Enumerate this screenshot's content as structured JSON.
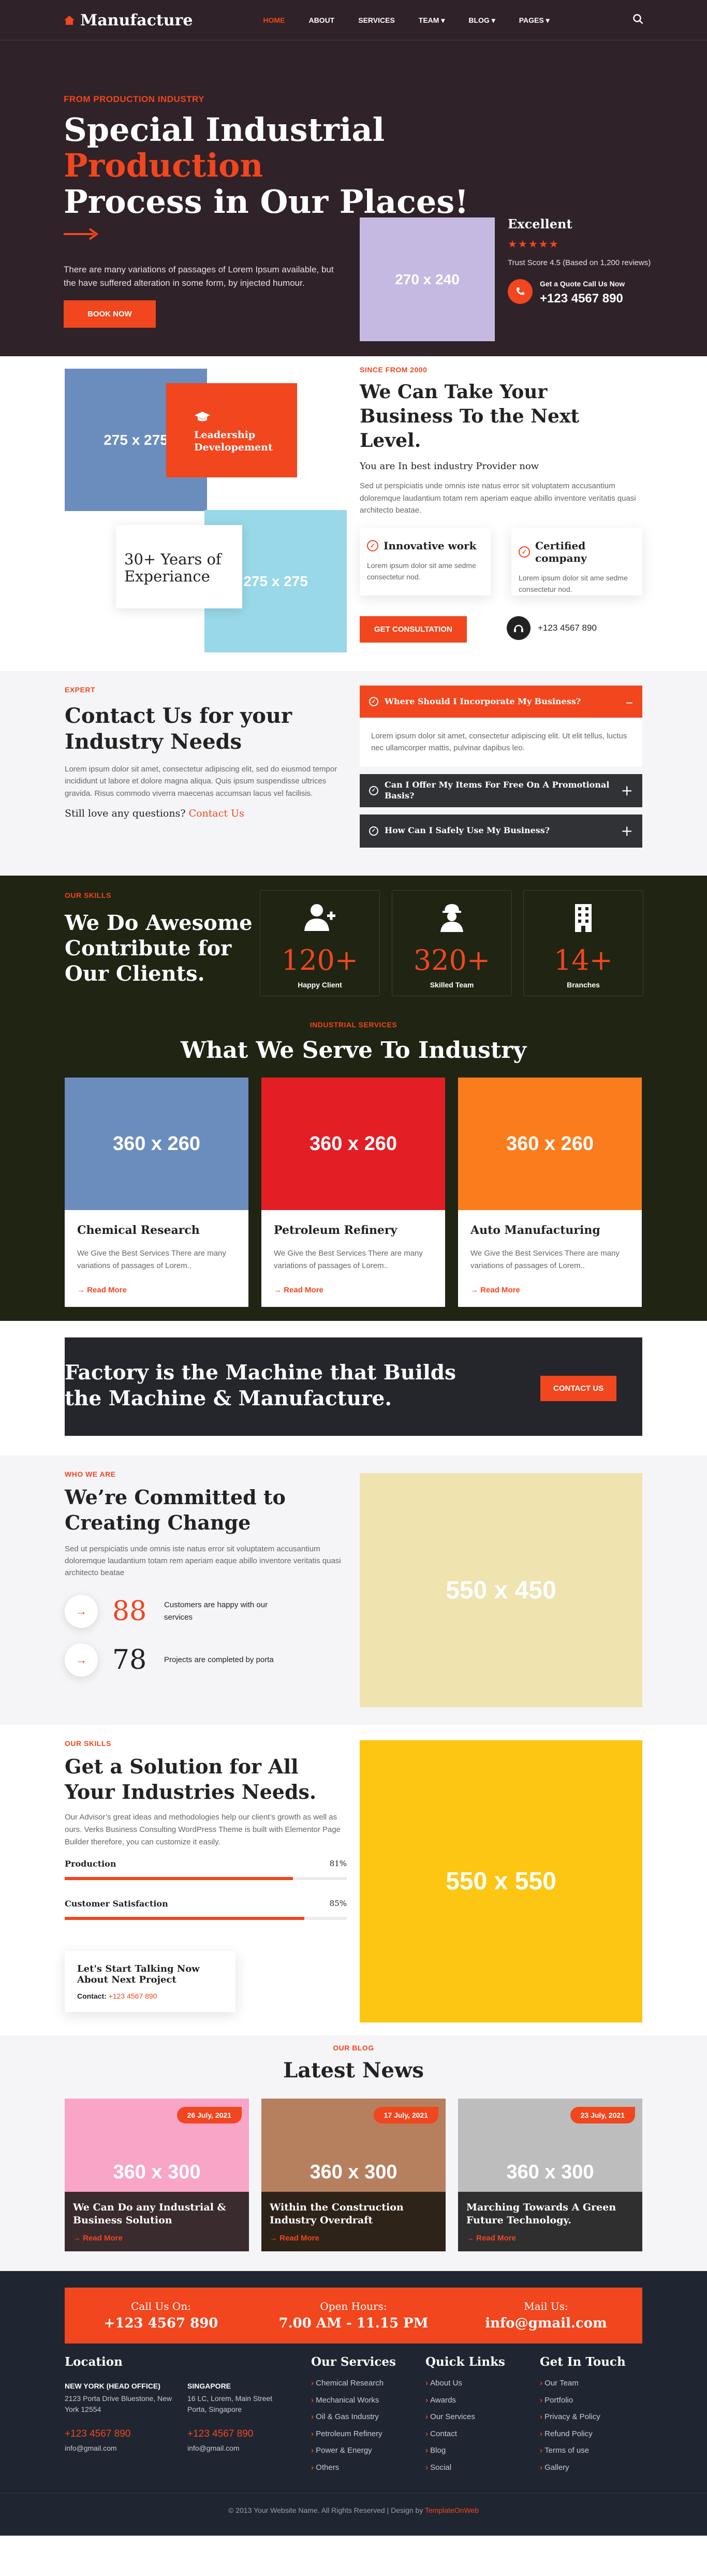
{
  "header": {
    "logo": "Manufacture",
    "nav": [
      {
        "label": "HOME"
      },
      {
        "label": "ABOUT"
      },
      {
        "label": "SERVICES"
      },
      {
        "label": "TEAM"
      },
      {
        "label": "BLOG"
      },
      {
        "label": "PAGES"
      }
    ]
  },
  "hero": {
    "kicker": "FROM PRODUCTION INDUSTRY",
    "title_a": "Special Industrial ",
    "title_b": "Production",
    "title_c": "Process in Our Places!",
    "desc": "There are many variations of passages of Lorem Ipsum available, but the have suffered alteration in some form, by injected humour.",
    "btn": "BOOK NOW",
    "img": "270 x 240",
    "rating_title": "Excellent",
    "stars": "★★★★★",
    "trust": "Trust Score 4.5 (Based on 1,200 reviews)",
    "call_label": "Get a Quote Call Us Now",
    "call_phone": "+123 4567 890"
  },
  "about": {
    "img1": "275 x 275",
    "badge": "Leadership Developement",
    "img2": "275 x 275",
    "years": "30+ Years of Experiance",
    "kicker": "SINCE FROM 2000",
    "title": "We Can Take Your Business To the Next Level.",
    "sub": "You are In best industry Provider now",
    "para": "Sed ut perspiciatis unde omnis iste natus error sit voluptatem accusantium doloremque laudantium totam rem aperiam eaque abillo inventore veritatis quasi architecto beatae.",
    "feats": [
      {
        "title": "Innovative work",
        "text": "Lorem ipsum dolor sit ame sedme consectetur nod."
      },
      {
        "title": "Certified company",
        "text": "Lorem ipsum dolor sit ame sedme consectetur nod."
      }
    ],
    "btn": "GET CONSULTATION",
    "phone": "+123 4567 890"
  },
  "faq": {
    "kicker": "EXPERT",
    "title": "Contact Us for your Industry Needs",
    "para": "Lorem ipsum dolor sit amet, consectetur adipiscing elit, sed do eiusmod tempor incididunt ut labore et dolore magna aliqua. Quis ipsum suspendisse ultrices gravida. Risus commodo viverra maecenas accumsan lacus vel facilisis.",
    "question": "Still love any questions?",
    "contact": "Contact Us",
    "items": [
      {
        "q": "Where Should I Incorporate My Business?",
        "a": "Lorem ipsum dolor sit amet, consectetur adipiscing elit. Ut elit tellus, luctus nec ullamcorper mattis, pulvinar dapibus leo."
      },
      {
        "q": "Can I Offer My Items For Free On A Promotional Basis?"
      },
      {
        "q": "How Can I Safely Use My Business?"
      }
    ]
  },
  "stats": {
    "kicker": "OUR SKILLS",
    "title": "We Do Awesome Contribute for Our Clients.",
    "items": [
      {
        "num": "120+",
        "label": "Happy Client"
      },
      {
        "num": "320+",
        "label": "Skilled Team"
      },
      {
        "num": "14+",
        "label": "Branches"
      }
    ]
  },
  "services": {
    "kicker": "INDUSTRIAL SERVICES",
    "title": "What We Serve To Industry",
    "items": [
      {
        "img": "360 x 260",
        "title": "Chemical Research",
        "text": "We Give the Best Services There are many variations of passages of Lorem..",
        "more": "Read More"
      },
      {
        "img": "360 x 260",
        "title": "Petroleum Refinery",
        "text": "We Give the Best Services There are many variations of passages of Lorem..",
        "more": "Read More"
      },
      {
        "img": "360 x 260",
        "title": "Auto Manufacturing",
        "text": "We Give the Best Services There are many variations of passages of Lorem..",
        "more": "Read More"
      }
    ]
  },
  "cta": {
    "title": "Factory is the Machine that Builds the Machine & Manufacture.",
    "btn": "CONTACT US"
  },
  "commit": {
    "kicker": "WHO WE ARE",
    "title": "We’re Committed to Creating Change",
    "para": "Sed ut perspiciatis unde omnis iste natus error sit voluptatem accusantium doloremque laudantium totam rem aperiam eaque abillo inventore veritatis quasi architecto beatae",
    "stats": [
      {
        "num": "88",
        "text": "Customers are happy with our services"
      },
      {
        "num": "78",
        "text": "Projects are completed by porta"
      }
    ],
    "img": "550 x 450"
  },
  "skills": {
    "kicker": "OUR SKILLS",
    "title": "Get a Solution for All Your Industries Needs.",
    "para": "Our Advisor’s great ideas and methodologies help our client’s growth as well as ours. Verks Business Consulting WordPress Theme is built with Elementor Page Builder therefore, you can customize it easily.",
    "bars": [
      {
        "label": "Production",
        "pct": "81%",
        "value": 0.81
      },
      {
        "label": "Customer Satisfaction",
        "pct": "85%",
        "value": 0.85
      }
    ],
    "talk_title": "Let's Start Talking Now About Next Project",
    "talk_contact": "Contact:",
    "talk_phone": "+123 4567 890",
    "img": "550 x 550"
  },
  "blog": {
    "kicker": "OUR BLOG",
    "title": "Latest News",
    "posts": [
      {
        "date": "26 July, 2021",
        "img": "360 x 300",
        "title": "We Can Do any Industrial & Business Solution",
        "more": "Read More"
      },
      {
        "date": "17 July, 2021",
        "img": "360 x 300",
        "title": "Within the Construction Industry Overdraft",
        "more": "Read More"
      },
      {
        "date": "23 July, 2021",
        "img": "360 x 300",
        "title": "Marching Towards A Green Future Technology.",
        "more": "Read More"
      }
    ]
  },
  "footer": {
    "bar": [
      {
        "a": "Call Us On:",
        "b": "+123 4567 890"
      },
      {
        "a": "Open Hours:",
        "b": "7.00 AM - 11.15 PM"
      },
      {
        "a": "Mail Us:",
        "b": "info@gmail.com"
      }
    ],
    "location": {
      "title": "Location",
      "offices": [
        {
          "name": "NEW YORK (HEAD OFFICE)",
          "addr": "2123 Porta Drive Bluestone, New York 12554",
          "phone": "+123 4567 890",
          "mail": "info@gmail.com"
        },
        {
          "name": "SINGAPORE",
          "addr": "16 LC, Lorem, Main Street Porta, Singapore",
          "phone": "+123 4567 890",
          "mail": "info@gmail.com"
        }
      ]
    },
    "services": {
      "title": "Our Services",
      "items": [
        "Chemical Research",
        "Mechanical Works",
        "Oil & Gas Industry",
        "Petroleum Refinery",
        "Power & Energy",
        "Others"
      ]
    },
    "links": {
      "title": "Quick Links",
      "items": [
        "About Us",
        "Awards",
        "Our Services",
        "Contact",
        "Blog",
        "Social"
      ]
    },
    "touch": {
      "title": "Get In Touch",
      "items": [
        "Our Team",
        "Portfolio",
        "Privacy & Policy",
        "Refund Policy",
        "Terms of use",
        "Gallery"
      ]
    },
    "copy": "© 2013 Your Website Name. All Rights Reserved | Design by ",
    "copy_link": "TemplateOnWeb"
  },
  "colors": {
    "accent": "#f1461e",
    "dark": "#2f2228",
    "green_dark": "#1f2413",
    "footer": "#1f2631"
  }
}
